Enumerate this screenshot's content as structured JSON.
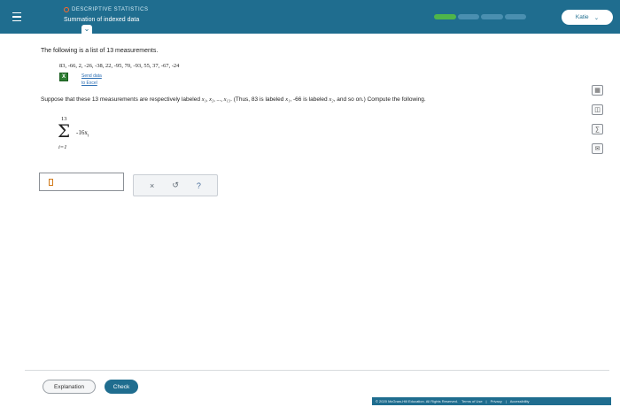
{
  "header": {
    "category": "DESCRIPTIVE STATISTICS",
    "title": "Summation of indexed data",
    "user": "Katie",
    "progress": {
      "segments": 4,
      "completed": 1
    }
  },
  "problem": {
    "intro": "The following is a list of 13 measurements.",
    "measurements": "83, -66, 2, -26, -38, 22, -95, 70, -93, 55, 37, -67, -24",
    "excel_link_line1": "Send data",
    "excel_link_line2": "to Excel",
    "suppose_a": "Suppose that these 13 measurements are respectively labeled ",
    "suppose_vars": "x₁, x₂, ..., x₁₃",
    "suppose_b": ". (Thus, 83 is labeled ",
    "suppose_x1": "x₁",
    "suppose_c": ", -66 is labeled ",
    "suppose_x2": "x₂",
    "suppose_d": ", and so on.) Compute the following.",
    "sum_upper": "13",
    "sum_lower": "i=1",
    "sum_term": "-16x",
    "sum_term_sub": "i"
  },
  "answer": {
    "value": ""
  },
  "keypad": {
    "clear": "×",
    "undo": "↺",
    "help": "?"
  },
  "buttons": {
    "explanation": "Explanation",
    "check": "Check"
  },
  "footer": {
    "copyright": "© 2020 McGraw-Hill Education. All Rights Reserved.",
    "terms": "Terms of Use",
    "privacy": "Privacy",
    "accessibility": "Accessibility"
  },
  "tools": [
    "calculator-icon",
    "table-icon",
    "formula-icon",
    "message-icon"
  ]
}
